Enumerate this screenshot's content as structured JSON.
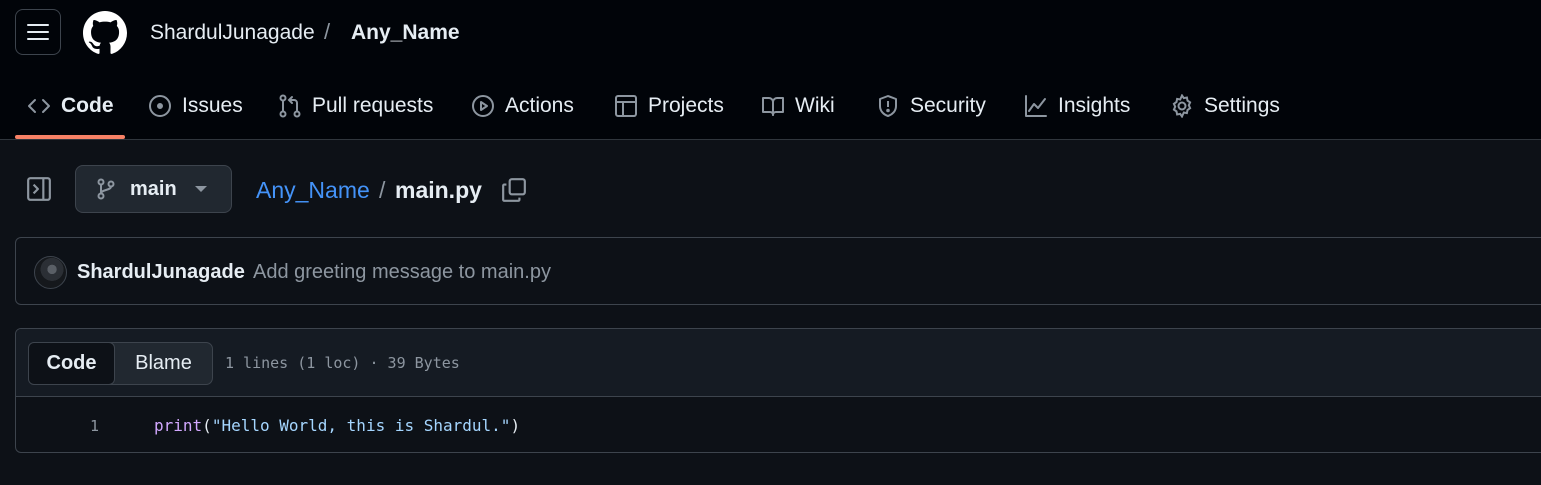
{
  "header": {
    "owner": "ShardulJunagade",
    "separator": "/",
    "repo": "Any_Name"
  },
  "nav": {
    "tabs": [
      {
        "label": "Code",
        "icon": "code-icon",
        "active": true
      },
      {
        "label": "Issues",
        "icon": "issue-icon"
      },
      {
        "label": "Pull requests",
        "icon": "pull-request-icon"
      },
      {
        "label": "Actions",
        "icon": "play-icon"
      },
      {
        "label": "Projects",
        "icon": "table-icon"
      },
      {
        "label": "Wiki",
        "icon": "book-icon"
      },
      {
        "label": "Security",
        "icon": "shield-icon"
      },
      {
        "label": "Insights",
        "icon": "graph-icon"
      },
      {
        "label": "Settings",
        "icon": "gear-icon"
      }
    ]
  },
  "file_nav": {
    "branch": "main",
    "path_repo": "Any_Name",
    "path_separator": "/",
    "path_file": "main.py"
  },
  "commit": {
    "author": "ShardulJunagade",
    "message": "Add greeting message to main.py"
  },
  "file_view": {
    "code_tab": "Code",
    "blame_tab": "Blame",
    "meta": "1 lines (1 loc) · 39 Bytes",
    "lines": [
      {
        "number": "1",
        "fn": "print",
        "open": "(",
        "string": "\"Hello World, this is Shardul.\"",
        "close": ")"
      }
    ]
  },
  "colors": {
    "background": "#0d1117",
    "header_background": "#010409",
    "accent_underline": "#f78166",
    "link": "#4493f8",
    "muted_text": "#8d96a0"
  }
}
